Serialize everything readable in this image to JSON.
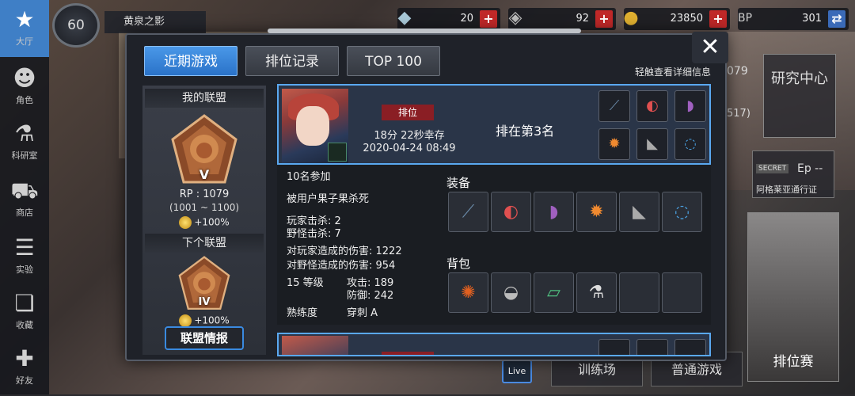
{
  "nav": {
    "items": [
      {
        "label": "大厅",
        "icon": "lobby-star-icon"
      },
      {
        "label": "角色",
        "icon": "character-icon"
      },
      {
        "label": "科研室",
        "icon": "flask-icon"
      },
      {
        "label": "商店",
        "icon": "cart-icon"
      },
      {
        "label": "实验",
        "icon": "books-icon"
      },
      {
        "label": "收藏",
        "icon": "book-icon"
      },
      {
        "label": "好友",
        "icon": "gamepad-icon"
      }
    ]
  },
  "player": {
    "level": "60",
    "name": "黄泉之影"
  },
  "resources": [
    {
      "name": "crystal",
      "value": "20"
    },
    {
      "name": "ticket",
      "value": "92"
    },
    {
      "name": "coin",
      "value": "23850"
    },
    {
      "name": "bp",
      "value": "301"
    }
  ],
  "tabs": [
    {
      "label": "近期游戏",
      "active": true
    },
    {
      "label": "排位记录",
      "active": false
    },
    {
      "label": "TOP 100",
      "active": false
    }
  ],
  "hint": "轻触查看详细信息",
  "alliance": {
    "my_title": "我的联盟",
    "my_rank": "V",
    "rp": "RP : 1079",
    "range": "(1001 ~ 1100)",
    "bonus": "+100%",
    "next_title": "下个联盟",
    "next_rank": "IV",
    "next_bonus": "+100%",
    "info_button": "联盟情报"
  },
  "match": {
    "tag": "排位",
    "survive": "18分 22秒幸存",
    "date": "2020-04-24 08:49",
    "placement": "排在第3名"
  },
  "detail": {
    "participants": "10名参加",
    "killed_by": "被用户果子果杀死",
    "player_kills": "玩家击杀: 2",
    "monster_kills": "野怪击杀: 7",
    "player_damage": "对玩家造成的伤害: 1222",
    "monster_damage": "对野怪造成的伤害: 954",
    "level": "15 等级",
    "attack": "攻击: 189",
    "defense": "防御: 242",
    "mastery_label": "熟练度",
    "mastery_value": "穿刺 A",
    "equip_title": "装备",
    "bag_title": "背包"
  },
  "background": {
    "research": "研究中心",
    "ranked": "排位赛",
    "training": "训练场",
    "normal": "普通游戏",
    "secret": "SECRET",
    "episode": "Ep --",
    "pass": "阿格莱亚通行证",
    "live": "Live",
    "partial_value": "079",
    "partial_value2": "517)"
  }
}
